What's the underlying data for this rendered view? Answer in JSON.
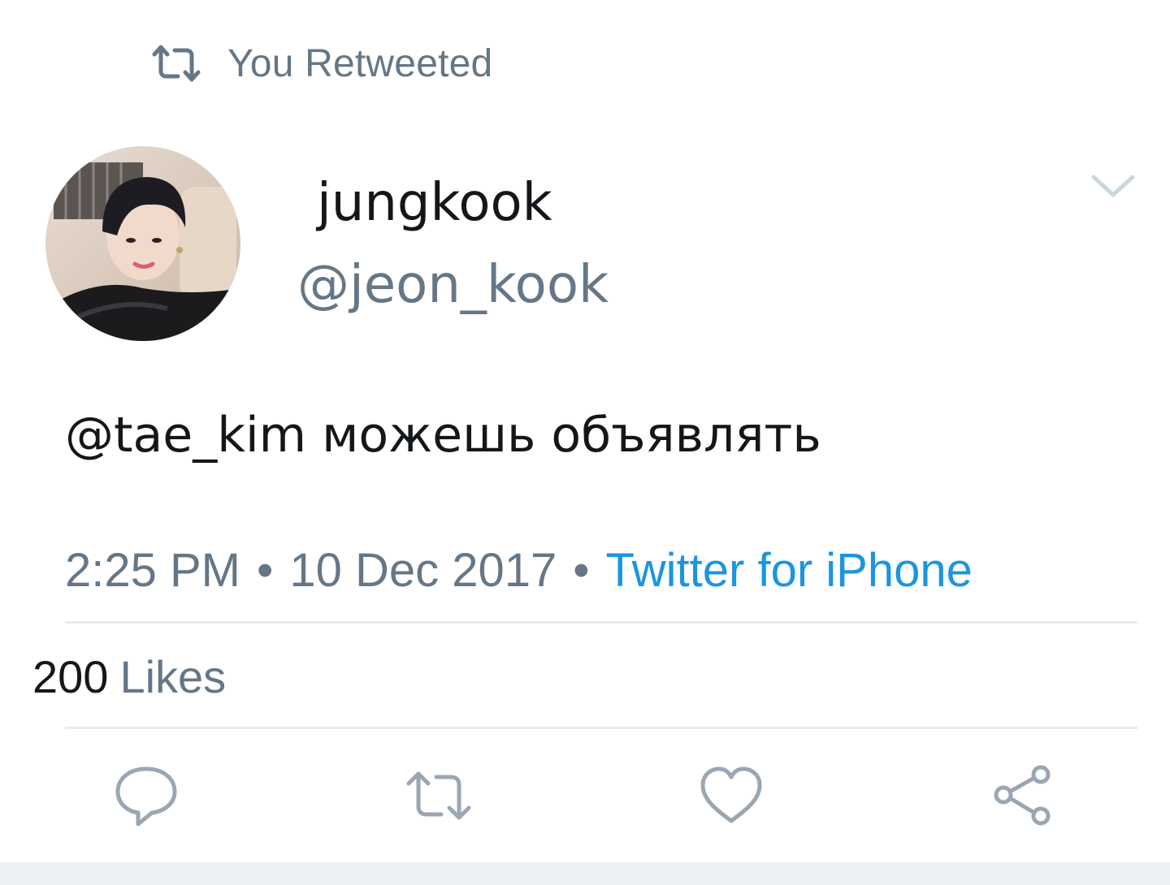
{
  "retweet_header": {
    "label": "You Retweeted",
    "icon": "retweet-icon"
  },
  "author": {
    "display_name": "jungkook",
    "handle": "@jeon_kook",
    "avatar": "avatar-photo"
  },
  "tweet": {
    "text": "@tae_kim можешь объявлять"
  },
  "meta": {
    "time": "2:25 PM",
    "separator": "•",
    "date": "10 Dec 2017",
    "source": "Twitter for iPhone"
  },
  "stats": {
    "likes_count": "200",
    "likes_label": "Likes"
  },
  "actions": [
    {
      "name": "reply",
      "icon": "reply-icon"
    },
    {
      "name": "retweet",
      "icon": "retweet-icon"
    },
    {
      "name": "like",
      "icon": "heart-icon"
    },
    {
      "name": "share",
      "icon": "share-icon"
    }
  ],
  "colors": {
    "text_primary": "#14171a",
    "text_secondary": "#657786",
    "link": "#1b95e0",
    "divider": "#e6ecf0",
    "icon": "#9aa6b1"
  }
}
